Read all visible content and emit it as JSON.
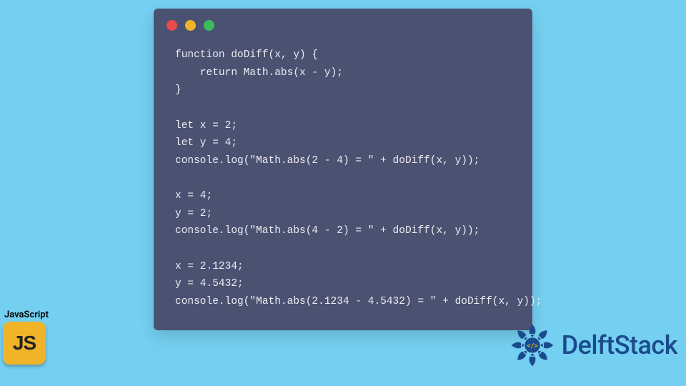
{
  "code": "function doDiff(x, y) {\n    return Math.abs(x - y);\n}\n\nlet x = 2;\nlet y = 4;\nconsole.log(\"Math.abs(2 - 4) = \" + doDiff(x, y));\n\nx = 4;\ny = 2;\nconsole.log(\"Math.abs(4 - 2) = \" + doDiff(x, y));\n\nx = 2.1234;\ny = 4.5432;\nconsole.log(\"Math.abs(2.1234 - 4.5432) = \" + doDiff(x, y));",
  "js_badge": {
    "label": "JavaScript",
    "icon_text": "JS"
  },
  "brand": {
    "name": "DelftStack"
  },
  "window_dots": {
    "red": "#e94b4b",
    "yellow": "#f0b429",
    "green": "#3bbd5a"
  }
}
